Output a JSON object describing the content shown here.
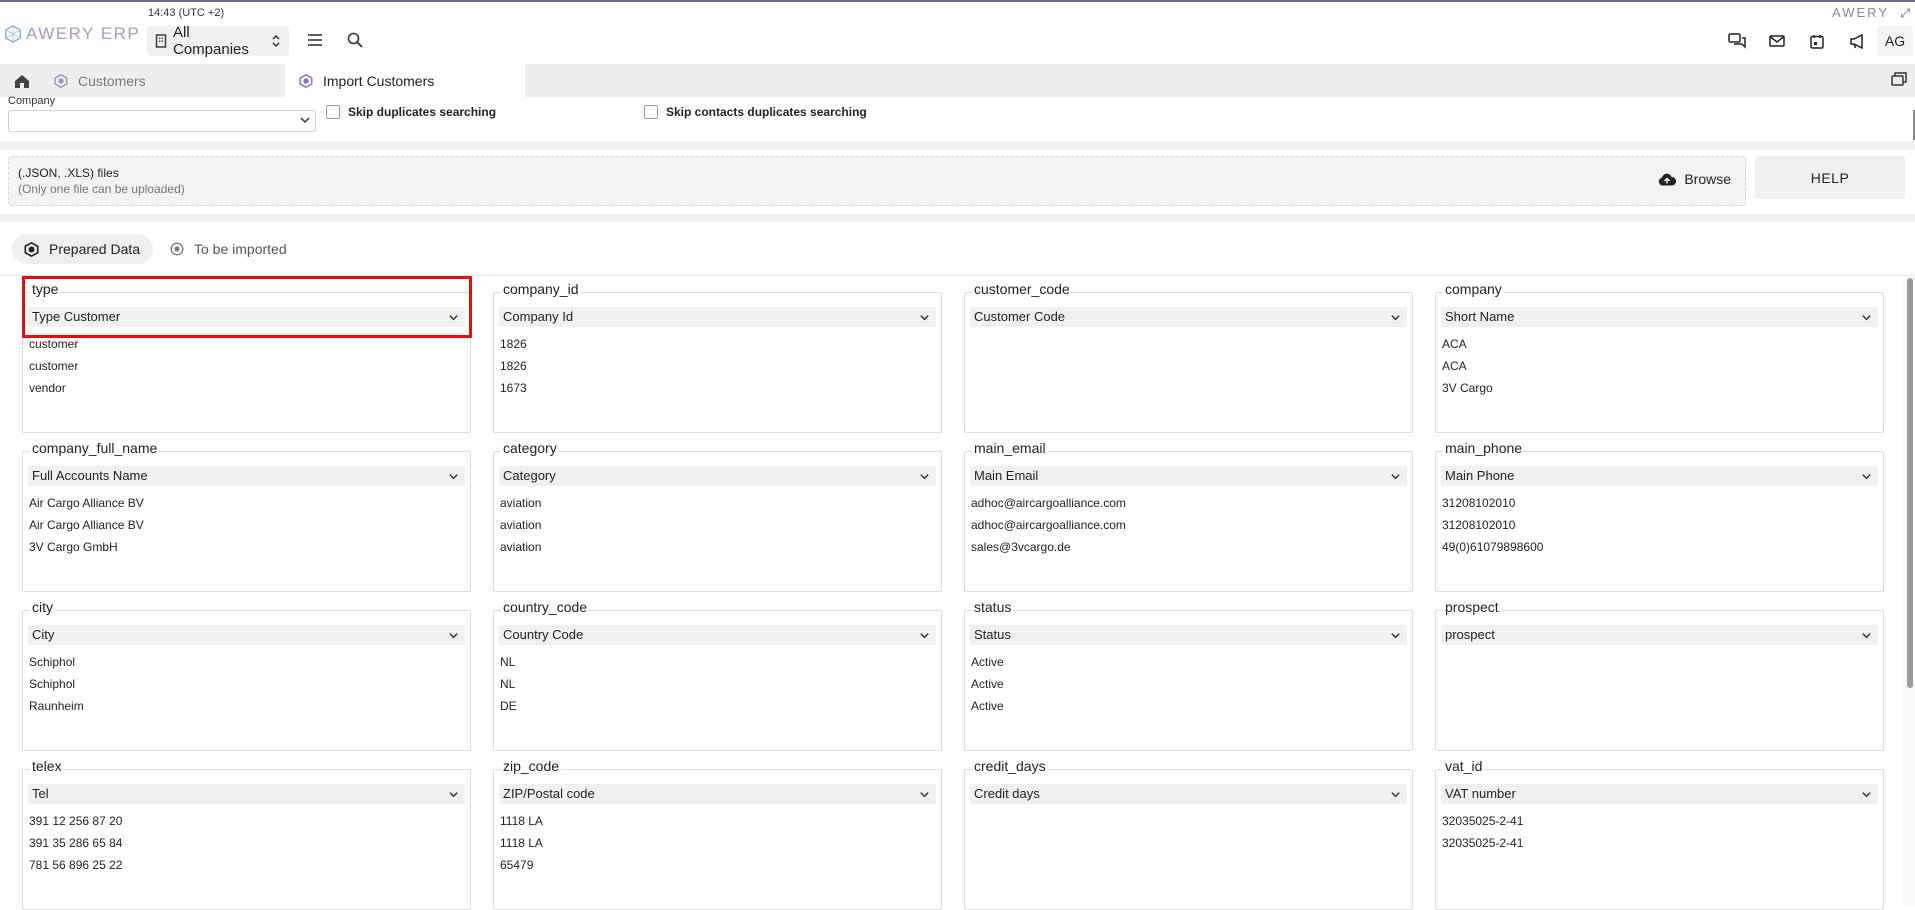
{
  "header": {
    "logo_text": "AWERY ERP",
    "clock": "14:43 (UTC +2)",
    "company_selector": "All Companies",
    "brand_small": "AWERY",
    "user_initials": "AG"
  },
  "tabs": [
    {
      "label": "Customers"
    },
    {
      "label": "Import Customers"
    }
  ],
  "options": {
    "company_label": "Company",
    "skip_duplicates": "Skip duplicates searching",
    "skip_contacts_duplicates": "Skip contacts duplicates searching"
  },
  "upload": {
    "title": "(.JSON, .XLS) files",
    "subtitle": "(Only one file can be uploaded)",
    "browse_label": "Browse",
    "help_label": "HELP"
  },
  "view_toggle": {
    "prepared": "Prepared Data",
    "to_import": "To be imported"
  },
  "fields": [
    {
      "name": "type",
      "mapping": "Type Customer",
      "values": [
        "customer",
        "customer",
        "vendor"
      ]
    },
    {
      "name": "company_id",
      "mapping": "Company Id",
      "values": [
        "1826",
        "1826",
        "1673"
      ]
    },
    {
      "name": "customer_code",
      "mapping": "Customer Code",
      "values": []
    },
    {
      "name": "company",
      "mapping": "Short Name",
      "values": [
        "ACA",
        "ACA",
        "3V Cargo"
      ]
    },
    {
      "name": "company_full_name",
      "mapping": "Full Accounts Name",
      "values": [
        "Air Cargo Alliance BV",
        "Air Cargo Alliance BV",
        "3V Cargo GmbH"
      ]
    },
    {
      "name": "category",
      "mapping": "Category",
      "values": [
        "aviation",
        "aviation",
        "aviation"
      ]
    },
    {
      "name": "main_email",
      "mapping": "Main Email",
      "values": [
        "adhoc@aircargoalliance.com",
        "adhoc@aircargoalliance.com",
        "sales@3vcargo.de"
      ]
    },
    {
      "name": "main_phone",
      "mapping": "Main Phone",
      "values": [
        "31208102010",
        "31208102010",
        "49(0)61079898600"
      ]
    },
    {
      "name": "city",
      "mapping": "City",
      "values": [
        "Schiphol",
        "Schiphol",
        "Raunheim"
      ]
    },
    {
      "name": "country_code",
      "mapping": "Country Code",
      "values": [
        "NL",
        "NL",
        "DE"
      ]
    },
    {
      "name": "status",
      "mapping": "Status",
      "values": [
        "Active",
        "Active",
        "Active"
      ]
    },
    {
      "name": "prospect",
      "mapping": "prospect",
      "values": []
    },
    {
      "name": "telex",
      "mapping": "Tel",
      "values": [
        "391 12 256 87 20",
        "391 35 286 65 84",
        "781 56 896 25 22"
      ]
    },
    {
      "name": "zip_code",
      "mapping": "ZIP/Postal code",
      "values": [
        "1118 LA",
        "1118 LA",
        "65479"
      ]
    },
    {
      "name": "credit_days",
      "mapping": "Credit days",
      "values": []
    },
    {
      "name": "vat_id",
      "mapping": "VAT number",
      "values": [
        "32035025-2-41",
        "32035025-2-41"
      ]
    }
  ]
}
